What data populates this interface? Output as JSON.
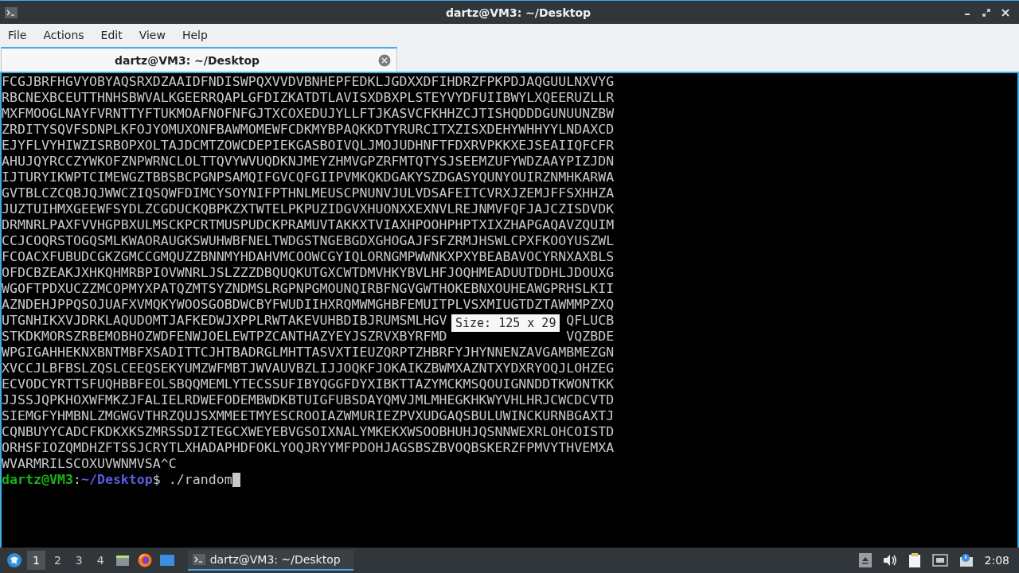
{
  "window": {
    "title": "dartz@VM3: ~/Desktop"
  },
  "menu": [
    "File",
    "Actions",
    "Edit",
    "View",
    "Help"
  ],
  "tabs": [
    {
      "label": "dartz@VM3: ~/Desktop",
      "selected": true
    }
  ],
  "terminal": {
    "lines": [
      {
        "text": "FCGJBRFHGVYOBYAQSRXDZAAIDFNDISWPQXVVDVBNHEPFEDKLJGDXXDFIHDRZFPKPDJAQGUULNXVYG"
      },
      {
        "text": "RBCNEXBCEUTTHNHSBWVALKGEERRQAPLGFDIZKATDTLAVISXDBXPLSTEYVYDFUIIBWYLXQEERUZLLR"
      },
      {
        "text": "MXFMOOGLNAYFVRNTTYFTUKMOAFNOFNFGJTXCOXEDUJYLLFTJKASVCFKHHZCJTISHQDDDGUNUUNZBW"
      },
      {
        "text": "ZRDITYSQVFSDNPLKFOJYOMUXONFBAWMOMEWFCDKMYBPAQKKDTYRURCITXZISXDEHYWHHYYLNDAXCD"
      },
      {
        "text": "EJYFLVYHIWZISRBOPXOLTAJDCMTZOWCDEPIEKGASBOIVQLJMOJUDHNFTFDXRVPKKXEJSEAIIQFCFR"
      },
      {
        "text": "AHUJQYRCCZYWKOFZNPWRNCLOLTTQVYWVUQDKNJMEYZHMVGPZRFMTQTYSJSEEMZUFYWDZAAYPIZJDN"
      },
      {
        "text": "IJTURYIKWPTCIMEWGZTBBSBCPGNPSAMQIFGVCQFGIIPVMKQKDGAKYSZDGASYQUNYOUIRZNMHKARWA"
      },
      {
        "text": "GVTBLCZCQBJQJWWCZIQSQWFDIMCYSOYNIFPTHNLMEUSCPNUNVJULVDSAFEITCVRXJZEMJFFSXHHZA"
      },
      {
        "text": "JUZTUIHMXGEEWFSYDLZCGDUCKQBPKZXTWTELPKPUZIDGVXHUONXXEXNVLREJNMVFQFJAJCZISDVDK"
      },
      {
        "text": "DRMNRLPAXFVVHGPBXULMSCKPCRTMUSPUDCKPRAMUVTAKKXTVIAXHPOOHPHPTXIXZHAPGAQAVZQUIM"
      },
      {
        "text": "CCJCOQRSTOGQSMLKWAORAUGKSWUHWBFNELTWDGSTNGEBGDXGHOGAJFSFZRMJHSWLCPXFKOOYUSZWL"
      },
      {
        "text": "FCOACXFUBUDCGKZGMCCGMQUZZBNNMYHDAHVMCOOWCGYIQLORNGMPWWNKXPXYBEABAVOCYRNXAXBLS"
      },
      {
        "text": "OFDCBZEAKJXHKQHMRBPIOVWNRLJSLZZZDBQUQKUTGXCWTDMVHKYBVLHFJOQHMEADUUTDDHLJDOUXG"
      },
      {
        "text": "WGOFTPDXUCZZMCOPMYXPATQZMTSYZNDMSLRGPNPGMOUNQIRBFNGVGWTHOKEBNXOUHEAWGPRHSLKII"
      },
      {
        "text": "AZNDEHJPPQSOJUAFXVMQKYWOOSGOBDWCBYFWUDIIHXRQMWMGHBFEMUITPLVSXMIUGTDZTAWMMPZXQ"
      },
      {
        "text": "UTGNHIKXVJDRKLAQUDOMTJAFKEDWJXPPLRWTAKEVUHBDIBJRUMSMLHGV",
        "after": "QFLUCB"
      },
      {
        "text": "STKDKMORSZRBEMOBHOZWDFENWJOELEWTPZCANTHAZYEYJSZRVXBYRFMD",
        "after": "VQZBDE"
      },
      {
        "text": "WPGIGAHHEKNXBNTMBFXSADITTCJHTBADRGLMHTTASVXTIEUZQRPTZHBRFYJHYNNENZAVGAMBMEZGN"
      },
      {
        "text": "XVCCJLBFBSLZQSLCEEQSEKYUMZWFMBTJWVAUVBZLIJJOQKFJOKAIKZBWMXAZNTXYDXRYOQJLOHZEG"
      },
      {
        "text": "ECVODCYRTTSFUQHBBFEOLSBQQMEMLYTECSSUFIBYQGGFDYXIBKTTAZYMCKMSQOUIGNNDDTKWONTKK"
      },
      {
        "text": "JJSSJQPKHOXWFMKZJFALIELRDWEFODEMBWDKBTUIGFUBSDAYQMVJMLMHEGKHKWYVHLHRJCWCDCVTD"
      },
      {
        "text": "SIEMGFYHMBNLZMGWGVTHRZQUJSXMMEETMYESCROOIAZWMURIEZPVXUDGAQSBULUWINCKURNBGAXTJ"
      },
      {
        "text": "CQNBUYYCADCFKDKXKSZMRSSDIZTEGCXWEYEBVGSOIXNALYMKEKXWSOOBHUHJQSNNWEXRLOHCOISTD"
      },
      {
        "text": "ORHSFIOZQMDHZFTSSJCRYTLXHADAPHDFOKLYOQJRYYMFPDOHJAGSBSZBVOQBSKERZFPMVYTHVEMXA"
      },
      {
        "text": "WVARMRILSCOXUVWNMVSA^C"
      }
    ],
    "prompt": {
      "user": "dartz@VM3",
      "separator": ":",
      "path": "~/Desktop",
      "symbol": "$",
      "command": "./random"
    },
    "tooltip": "Size: 125 x 29"
  },
  "taskbar": {
    "workspaces": [
      {
        "label": "1",
        "selected": true
      },
      {
        "label": "2",
        "selected": false
      },
      {
        "label": "3",
        "selected": false
      },
      {
        "label": "4",
        "selected": false
      }
    ],
    "task": {
      "label": "dartz@VM3: ~/Desktop",
      "selected": true
    },
    "clock": "2:08"
  }
}
